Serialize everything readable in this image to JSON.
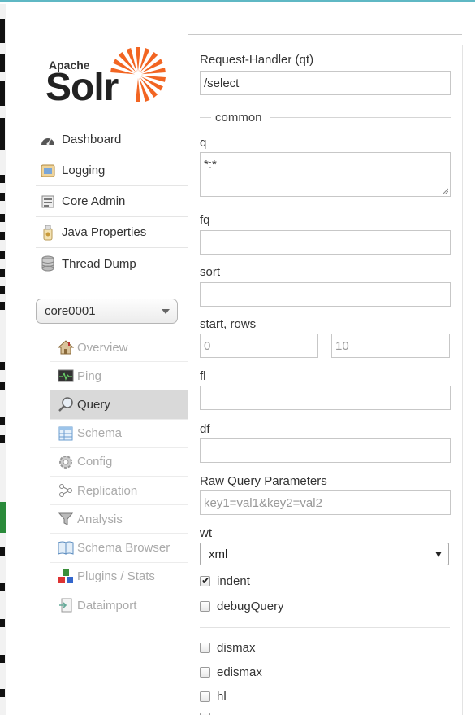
{
  "logo": {
    "top_text": "Apache",
    "main_text": "Solr"
  },
  "nav": [
    {
      "label": "Dashboard",
      "icon": "dashboard-icon"
    },
    {
      "label": "Logging",
      "icon": "logging-icon"
    },
    {
      "label": "Core Admin",
      "icon": "core-admin-icon"
    },
    {
      "label": "Java Properties",
      "icon": "java-properties-icon"
    },
    {
      "label": "Thread Dump",
      "icon": "thread-dump-icon"
    }
  ],
  "core_selector": {
    "value": "core0001"
  },
  "core_nav": [
    {
      "label": "Overview",
      "icon": "home-icon"
    },
    {
      "label": "Ping",
      "icon": "ping-icon"
    },
    {
      "label": "Query",
      "icon": "magnifier-icon",
      "active": true
    },
    {
      "label": "Schema",
      "icon": "schema-icon"
    },
    {
      "label": "Config",
      "icon": "gear-icon"
    },
    {
      "label": "Replication",
      "icon": "replication-icon"
    },
    {
      "label": "Analysis",
      "icon": "funnel-icon"
    },
    {
      "label": "Schema Browser",
      "icon": "book-icon"
    },
    {
      "label": "Plugins / Stats",
      "icon": "plugins-icon"
    },
    {
      "label": "Dataimport",
      "icon": "dataimport-icon"
    }
  ],
  "query_form": {
    "request_handler_label": "Request-Handler (qt)",
    "request_handler_value": "/select",
    "common_legend": "common",
    "q_label": "q",
    "q_value": "*:*",
    "fq_label": "fq",
    "sort_label": "sort",
    "start_rows_label": "start, rows",
    "start_placeholder": "0",
    "rows_placeholder": "10",
    "fl_label": "fl",
    "df_label": "df",
    "raw_label": "Raw Query Parameters",
    "raw_placeholder": "key1=val1&key2=val2",
    "wt_label": "wt",
    "wt_value": "xml",
    "indent_label": "indent",
    "indent_checked": true,
    "debug_label": "debugQuery",
    "dismax_label": "dismax",
    "edismax_label": "edismax",
    "hl_label": "hl"
  },
  "colors": {
    "accent_top": "#5fb8c4",
    "active_nav_bg": "#d9d9d9",
    "solr_orange": "#f26522",
    "disabled_text": "#aaaaaa"
  }
}
